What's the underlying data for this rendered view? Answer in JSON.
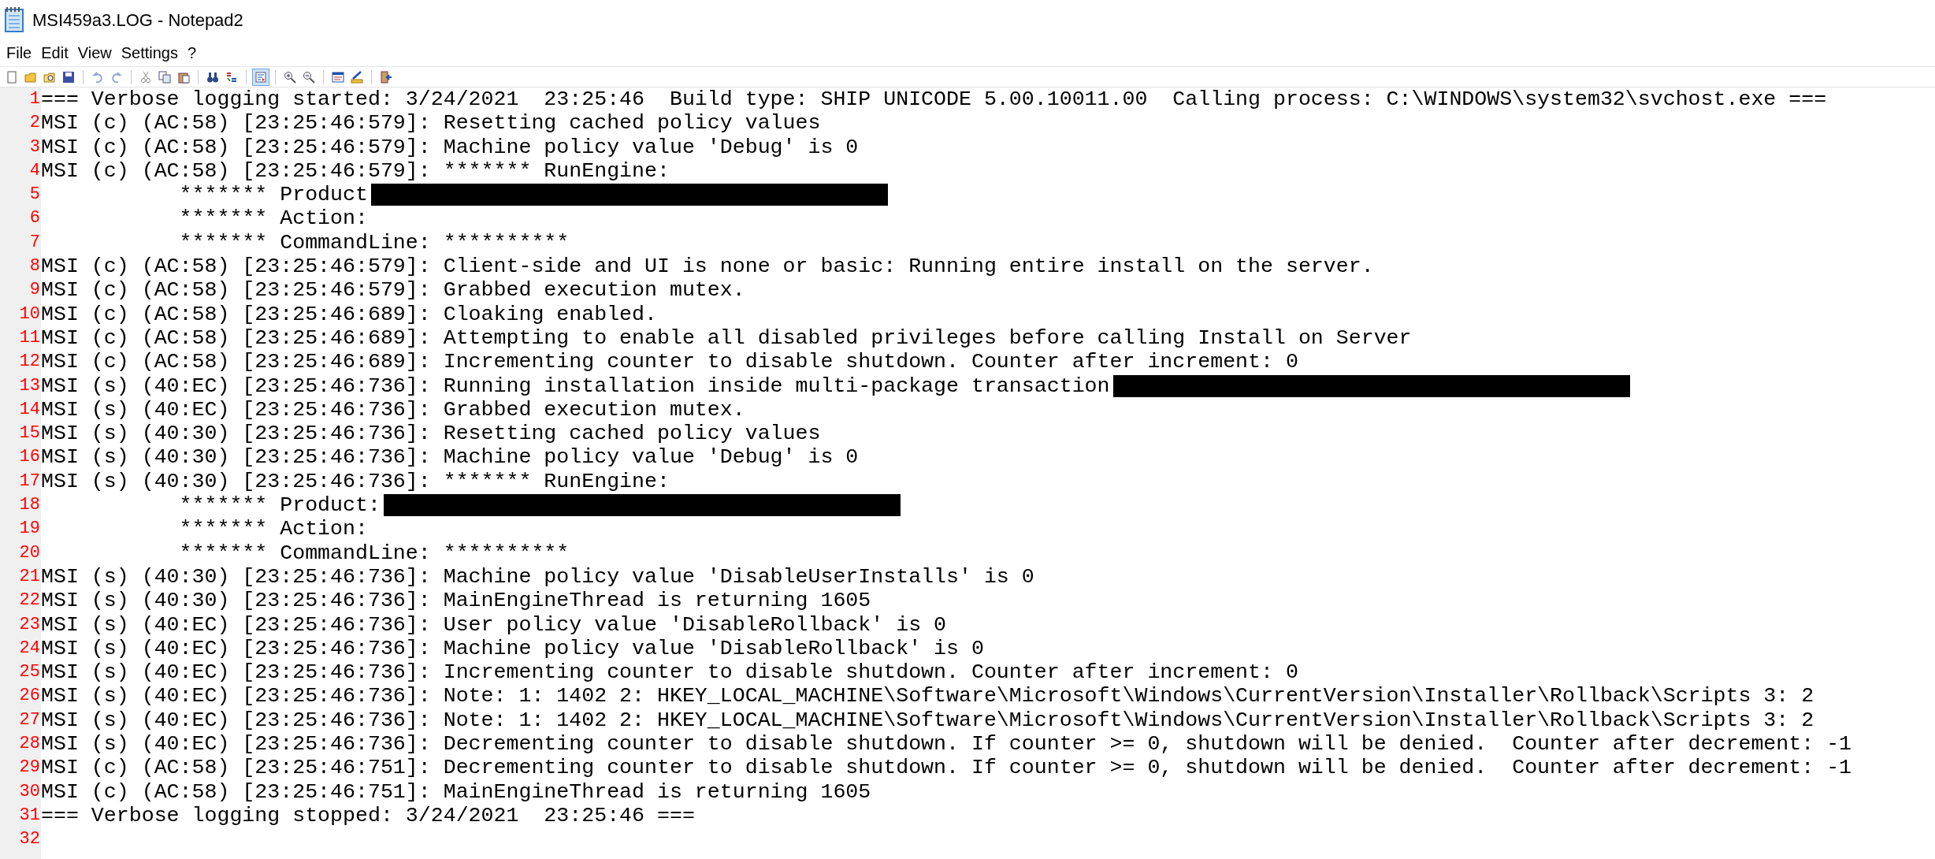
{
  "window": {
    "title": "MSI459a3.LOG - Notepad2"
  },
  "menu": [
    "File",
    "Edit",
    "View",
    "Settings",
    "?"
  ],
  "toolbar_groups": [
    [
      {
        "pressed": false
      },
      {
        "pressed": false
      },
      {
        "pressed": false
      },
      {
        "pressed": false
      }
    ],
    [
      {
        "pressed": false
      },
      {
        "pressed": false
      }
    ],
    [
      {
        "pressed": false
      },
      {
        "pressed": false
      },
      {
        "pressed": false
      }
    ],
    [
      {
        "pressed": false
      },
      {
        "pressed": false
      }
    ],
    [
      {
        "pressed": true
      }
    ],
    [
      {
        "pressed": false
      },
      {
        "pressed": false
      }
    ],
    [
      {
        "pressed": false
      },
      {
        "pressed": false
      }
    ],
    [
      {
        "pressed": false
      }
    ]
  ],
  "lines": [
    {
      "number": "1",
      "text": "=== Verbose logging started: 3/24/2021  23:25:46  Build type: SHIP UNICODE 5.00.10011.00  Calling process: C:\\WINDOWS\\system32\\svchost.exe ===",
      "redacted": false
    },
    {
      "number": "2",
      "text": "MSI (c) (AC:58) [23:25:46:579]: Resetting cached policy values",
      "redacted": false
    },
    {
      "number": "3",
      "text": "MSI (c) (AC:58) [23:25:46:579]: Machine policy value 'Debug' is 0",
      "redacted": false
    },
    {
      "number": "4",
      "text": "MSI (c) (AC:58) [23:25:46:579]: ******* RunEngine:",
      "redacted": false
    },
    {
      "number": "5",
      "text": "           ******* Product",
      "redacted": true
    },
    {
      "number": "6",
      "text": "           ******* Action:",
      "redacted": false
    },
    {
      "number": "7",
      "text": "           ******* CommandLine: **********",
      "redacted": false
    },
    {
      "number": "8",
      "text": "MSI (c) (AC:58) [23:25:46:579]: Client-side and UI is none or basic: Running entire install on the server.",
      "redacted": false
    },
    {
      "number": "9",
      "text": "MSI (c) (AC:58) [23:25:46:579]: Grabbed execution mutex.",
      "redacted": false
    },
    {
      "number": "10",
      "text": "MSI (c) (AC:58) [23:25:46:689]: Cloaking enabled.",
      "redacted": false
    },
    {
      "number": "11",
      "text": "MSI (c) (AC:58) [23:25:46:689]: Attempting to enable all disabled privileges before calling Install on Server",
      "redacted": false
    },
    {
      "number": "12",
      "text": "MSI (c) (AC:58) [23:25:46:689]: Incrementing counter to disable shutdown. Counter after increment: 0",
      "redacted": false
    },
    {
      "number": "13",
      "text": "MSI (s) (40:EC) [23:25:46:736]: Running installation inside multi-package transaction",
      "redacted": true
    },
    {
      "number": "14",
      "text": "MSI (s) (40:EC) [23:25:46:736]: Grabbed execution mutex.",
      "redacted": false
    },
    {
      "number": "15",
      "text": "MSI (s) (40:30) [23:25:46:736]: Resetting cached policy values",
      "redacted": false
    },
    {
      "number": "16",
      "text": "MSI (s) (40:30) [23:25:46:736]: Machine policy value 'Debug' is 0",
      "redacted": false
    },
    {
      "number": "17",
      "text": "MSI (s) (40:30) [23:25:46:736]: ******* RunEngine:",
      "redacted": false
    },
    {
      "number": "18",
      "text": "           ******* Product:",
      "redacted": true
    },
    {
      "number": "19",
      "text": "           ******* Action:",
      "redacted": false
    },
    {
      "number": "20",
      "text": "           ******* CommandLine: **********",
      "redacted": false
    },
    {
      "number": "21",
      "text": "MSI (s) (40:30) [23:25:46:736]: Machine policy value 'DisableUserInstalls' is 0",
      "redacted": false
    },
    {
      "number": "22",
      "text": "MSI (s) (40:30) [23:25:46:736]: MainEngineThread is returning 1605",
      "redacted": false
    },
    {
      "number": "23",
      "text": "MSI (s) (40:EC) [23:25:46:736]: User policy value 'DisableRollback' is 0",
      "redacted": false
    },
    {
      "number": "24",
      "text": "MSI (s) (40:EC) [23:25:46:736]: Machine policy value 'DisableRollback' is 0",
      "redacted": false
    },
    {
      "number": "25",
      "text": "MSI (s) (40:EC) [23:25:46:736]: Incrementing counter to disable shutdown. Counter after increment: 0",
      "redacted": false
    },
    {
      "number": "26",
      "text": "MSI (s) (40:EC) [23:25:46:736]: Note: 1: 1402 2: HKEY_LOCAL_MACHINE\\Software\\Microsoft\\Windows\\CurrentVersion\\Installer\\Rollback\\Scripts 3: 2",
      "redacted": false
    },
    {
      "number": "27",
      "text": "MSI (s) (40:EC) [23:25:46:736]: Note: 1: 1402 2: HKEY_LOCAL_MACHINE\\Software\\Microsoft\\Windows\\CurrentVersion\\Installer\\Rollback\\Scripts 3: 2",
      "redacted": false
    },
    {
      "number": "28",
      "text": "MSI (s) (40:EC) [23:25:46:736]: Decrementing counter to disable shutdown. If counter >= 0, shutdown will be denied.  Counter after decrement: -1",
      "redacted": false
    },
    {
      "number": "29",
      "text": "MSI (c) (AC:58) [23:25:46:751]: Decrementing counter to disable shutdown. If counter >= 0, shutdown will be denied.  Counter after decrement: -1",
      "redacted": false
    },
    {
      "number": "30",
      "text": "MSI (c) (AC:58) [23:25:46:751]: MainEngineThread is returning 1605",
      "redacted": false
    },
    {
      "number": "31",
      "text": "=== Verbose logging stopped: 3/24/2021  23:25:46 ===",
      "redacted": false
    },
    {
      "number": "32",
      "redacted": false
    }
  ]
}
